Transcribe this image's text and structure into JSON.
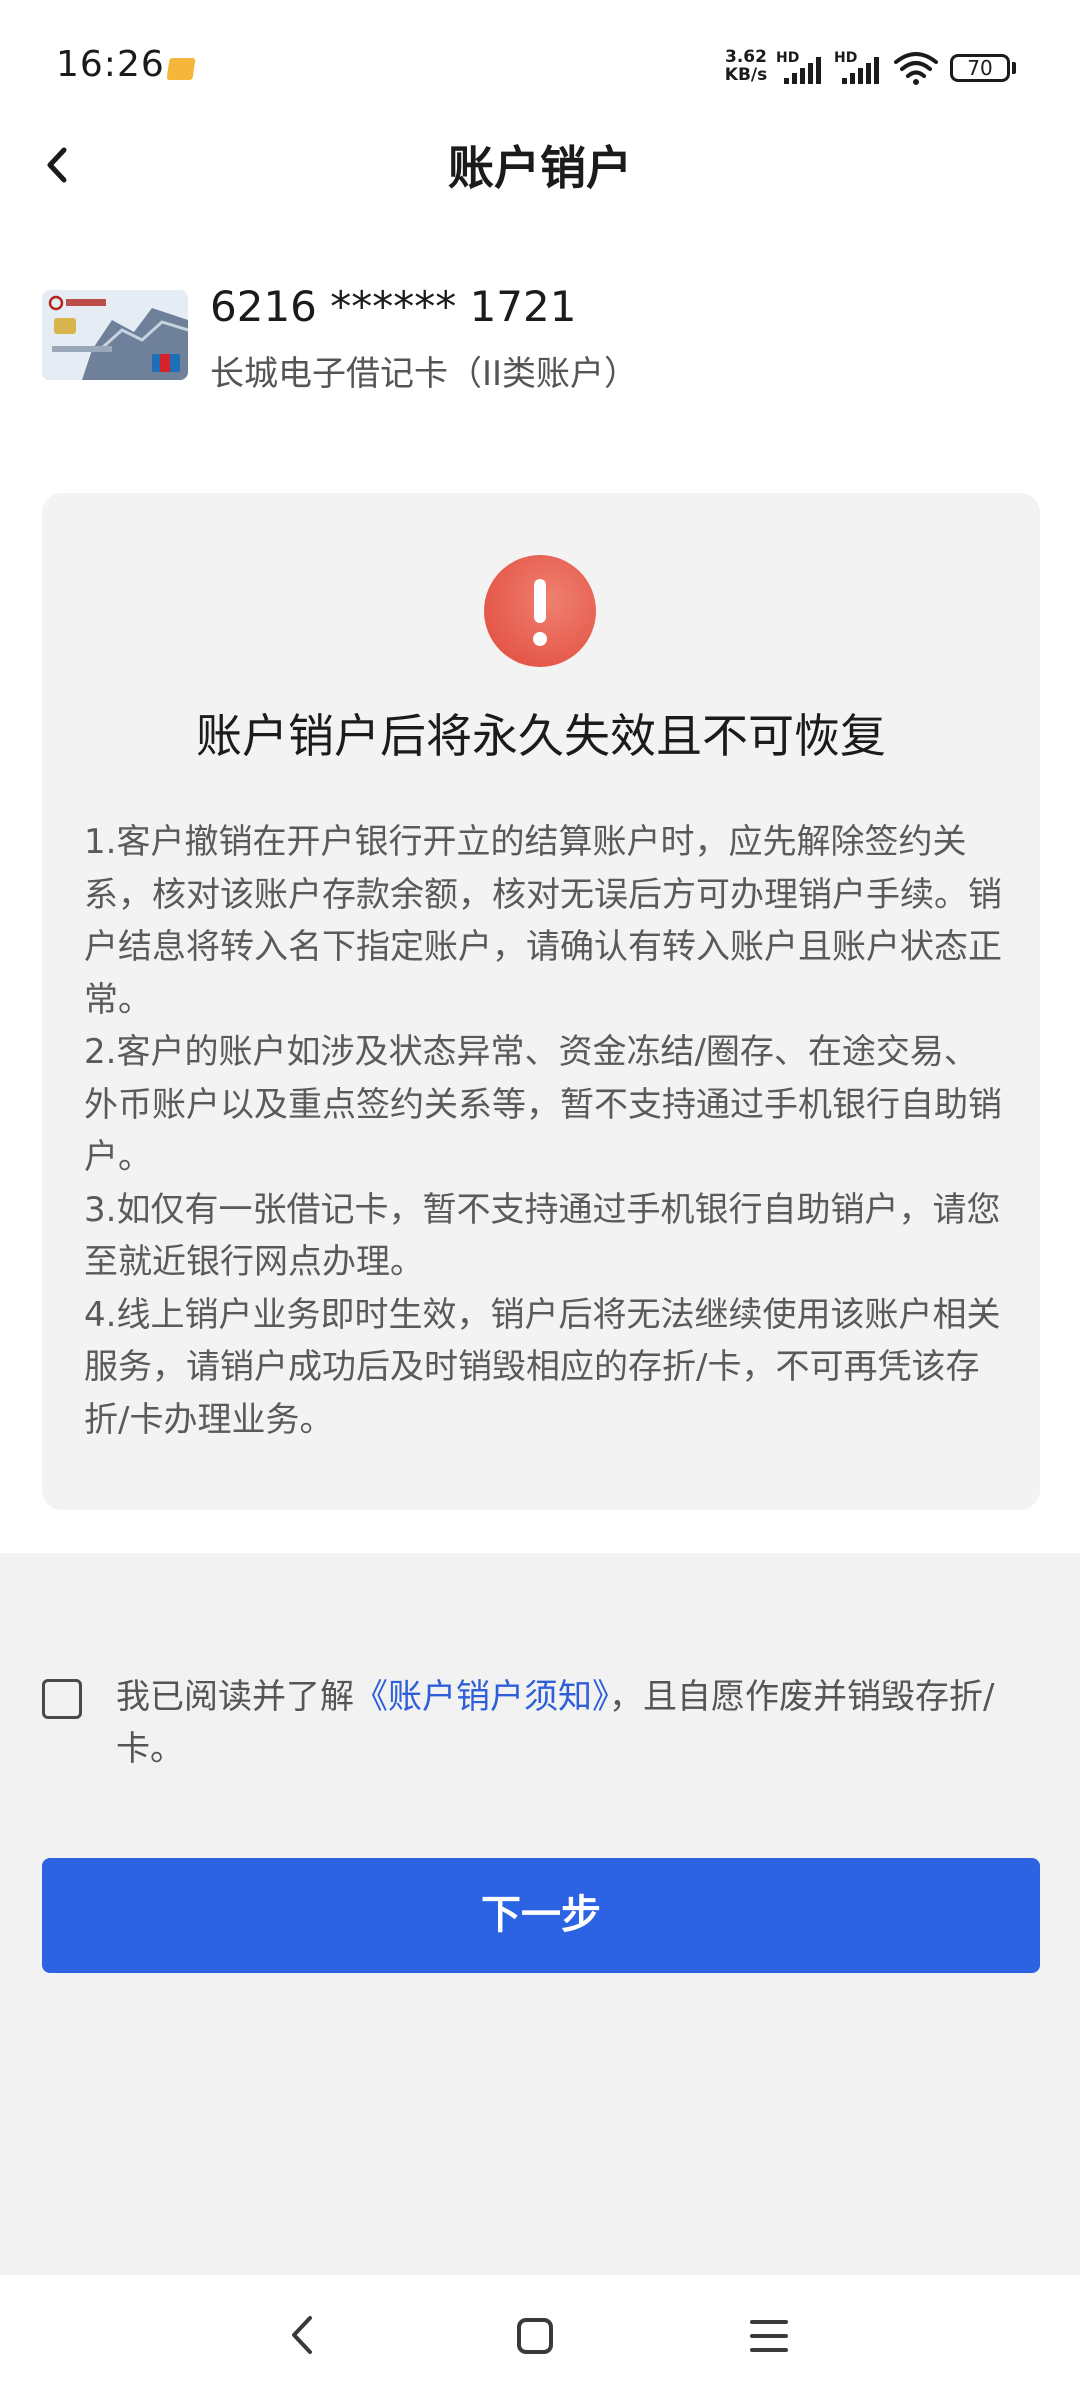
{
  "status_bar": {
    "time": "16:26",
    "net_speed_value": "3.62",
    "net_speed_unit": "KB/s",
    "hd_label_1": "HD",
    "hd_label_2": "HD",
    "battery": "70"
  },
  "header": {
    "title": "账户销户"
  },
  "card": {
    "number": "6216 ****** 1721",
    "name": "长城电子借记卡（II类账户）"
  },
  "warning": {
    "title": "账户销户后将永久失效且不可恢复",
    "items": [
      "1.客户撤销在开户银行开立的结算账户时，应先解除签约关系，核对该账户存款余额，核对无误后方可办理销户手续。销户结息将转入名下指定账户，请确认有转入账户且账户状态正常。",
      "2.客户的账户如涉及状态异常、资金冻结/圈存、在途交易、外币账户以及重点签约关系等，暂不支持通过手机银行自助销户。",
      "3.如仅有一张借记卡，暂不支持通过手机银行自助销户，请您至就近银行网点办理。",
      "4.线上销户业务即时生效，销户后将无法继续使用该账户相关服务，请销户成功后及时销毁相应的存折/卡，不可再凭该存折/卡办理业务。"
    ]
  },
  "agreement": {
    "prefix": "我已阅读并了解",
    "link": "《账户销户须知》",
    "suffix": "，且自愿作废并销毁存折/卡。",
    "checked": false
  },
  "next_button": {
    "label": "下一步"
  },
  "colors": {
    "primary": "#2b63e3",
    "link": "#2e5fd8",
    "warning_icon": "#e5594b",
    "page_background": "#f2f2f2"
  },
  "icons": {
    "back": "chevron-left-icon",
    "warning": "exclamation-icon",
    "nav_back": "nav-back-icon",
    "nav_home": "nav-home-icon",
    "nav_menu": "nav-menu-icon"
  }
}
